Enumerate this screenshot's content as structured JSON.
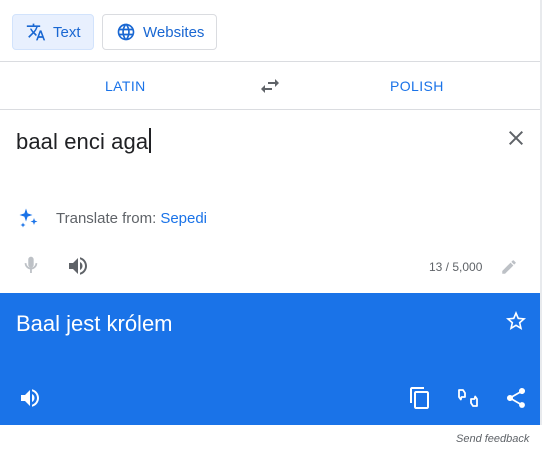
{
  "modes": {
    "text_label": "Text",
    "websites_label": "Websites"
  },
  "languages": {
    "source": "LATIN",
    "target": "POLISH"
  },
  "source": {
    "text": "baal enci aga",
    "detect_prefix": "Translate from:",
    "detected_language": "Sepedi",
    "char_count": "13 / 5,000"
  },
  "target": {
    "text": "Baal jest królem"
  },
  "footer": {
    "feedback": "Send feedback"
  },
  "colors": {
    "accent": "#1a73e8",
    "target_bg": "#1a73e8",
    "icon_gray": "#5f6368"
  },
  "icons": [
    "translate-icon",
    "globe-icon",
    "swap-icon",
    "close-icon",
    "sparkle-icon",
    "mic-icon",
    "speaker-icon",
    "pencil-icon",
    "star-icon",
    "copy-icon",
    "rate-icon",
    "share-icon"
  ]
}
